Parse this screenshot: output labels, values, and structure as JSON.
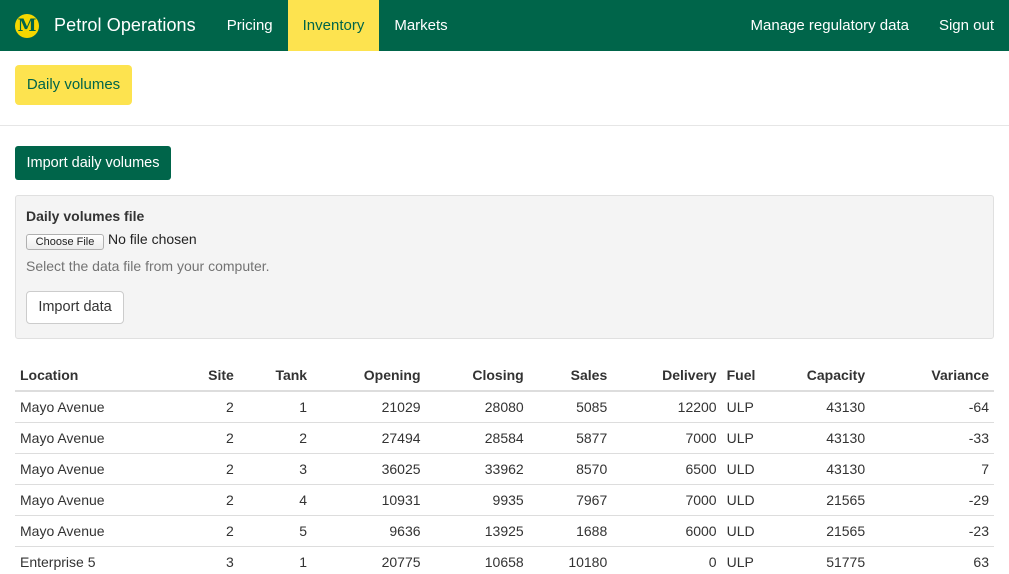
{
  "navbar": {
    "brand_letter": "M",
    "brand_name": "Petrol Operations",
    "items": [
      {
        "label": "Pricing",
        "active": false
      },
      {
        "label": "Inventory",
        "active": true
      },
      {
        "label": "Markets",
        "active": false
      }
    ],
    "right_items": [
      {
        "label": "Manage regulatory data"
      },
      {
        "label": "Sign out"
      }
    ]
  },
  "subnav": {
    "active_pill": "Daily volumes"
  },
  "actions": {
    "import_daily_volumes": "Import daily volumes"
  },
  "import_panel": {
    "label": "Daily volumes file",
    "choose_file": "Choose File",
    "file_status": "No file chosen",
    "help": "Select the data file from your computer.",
    "import_button": "Import data"
  },
  "table": {
    "headers": [
      "Location",
      "Site",
      "Tank",
      "Opening",
      "Closing",
      "Sales",
      "Delivery",
      "Fuel",
      "Capacity",
      "Variance"
    ],
    "rows": [
      [
        "Mayo Avenue",
        "2",
        "1",
        "21029",
        "28080",
        "5085",
        "12200",
        "ULP",
        "43130",
        "-64"
      ],
      [
        "Mayo Avenue",
        "2",
        "2",
        "27494",
        "28584",
        "5877",
        "7000",
        "ULP",
        "43130",
        "-33"
      ],
      [
        "Mayo Avenue",
        "2",
        "3",
        "36025",
        "33962",
        "8570",
        "6500",
        "ULD",
        "43130",
        "7"
      ],
      [
        "Mayo Avenue",
        "2",
        "4",
        "10931",
        "9935",
        "7967",
        "7000",
        "ULD",
        "21565",
        "-29"
      ],
      [
        "Mayo Avenue",
        "2",
        "5",
        "9636",
        "13925",
        "1688",
        "6000",
        "ULD",
        "21565",
        "-23"
      ],
      [
        "Enterprise 5",
        "3",
        "1",
        "20775",
        "10658",
        "10180",
        "0",
        "ULP",
        "51775",
        "63"
      ]
    ]
  },
  "colors": {
    "brand_green": "#00654a",
    "accent_yellow": "#fde34f"
  }
}
